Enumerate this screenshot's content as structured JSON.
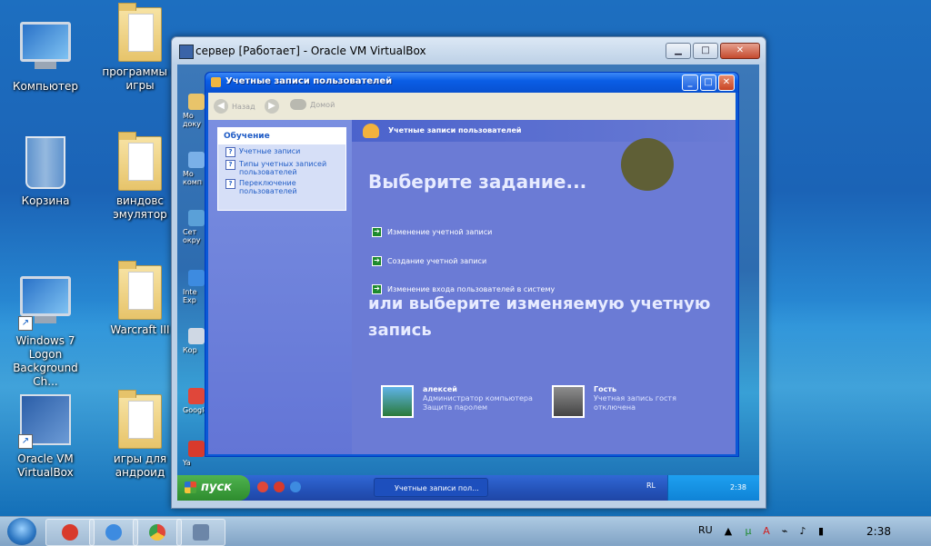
{
  "desktop": {
    "icons": [
      {
        "label": "Компьютер"
      },
      {
        "label": "программы и игры"
      },
      {
        "label": "Корзина"
      },
      {
        "label": "виндовс эмулятор"
      },
      {
        "label": "Windows 7 Logon Background Ch..."
      },
      {
        "label": "Warcraft III"
      },
      {
        "label": "Oracle VM VirtualBox"
      },
      {
        "label": "игры для андроид"
      }
    ]
  },
  "host_window": {
    "title": "сервер [Работает] - Oracle VM VirtualBox",
    "minimize": "▁",
    "maximize": "□",
    "close": "✕"
  },
  "vm": {
    "desktop_icons": [
      "Мо доку",
      "Мо комп",
      "Сет окру",
      "Inte Exp",
      "Кор",
      "Google",
      "Ya"
    ],
    "window": {
      "title": "Учетные записи пользователей",
      "toolbar": {
        "back": "Назад",
        "forward": "",
        "home": "Домой"
      },
      "learn": {
        "header": "Обучение",
        "links": [
          "Учетные записи",
          "Типы учетных записей пользователей",
          "Переключение пользователей"
        ]
      },
      "panel_header": "Учетные записи пользователей",
      "pick_task": "Выберите задание...",
      "tasks": [
        "Изменение учетной записи",
        "Создание учетной записи",
        "Изменение входа пользователей в систему"
      ],
      "or_pick": "или выберите изменяемую учетную запись",
      "accounts": [
        {
          "name": "алексей",
          "lines": [
            "Администратор компьютера",
            "Защита паролем"
          ]
        },
        {
          "name": "Гость",
          "lines": [
            "Учетная запись гостя",
            "отключена"
          ]
        }
      ]
    },
    "taskbar": {
      "start": "пуск",
      "task_button": "Учетные записи пол...",
      "lang": "RL",
      "clock": "2:38"
    }
  },
  "host_taskbar": {
    "lang": "RU",
    "clock": "2:38"
  },
  "colors": {
    "xp_blue": "#0a58d6",
    "xp_panel": "#6b7bd5",
    "xp_start_green": "#2e8c2e"
  }
}
